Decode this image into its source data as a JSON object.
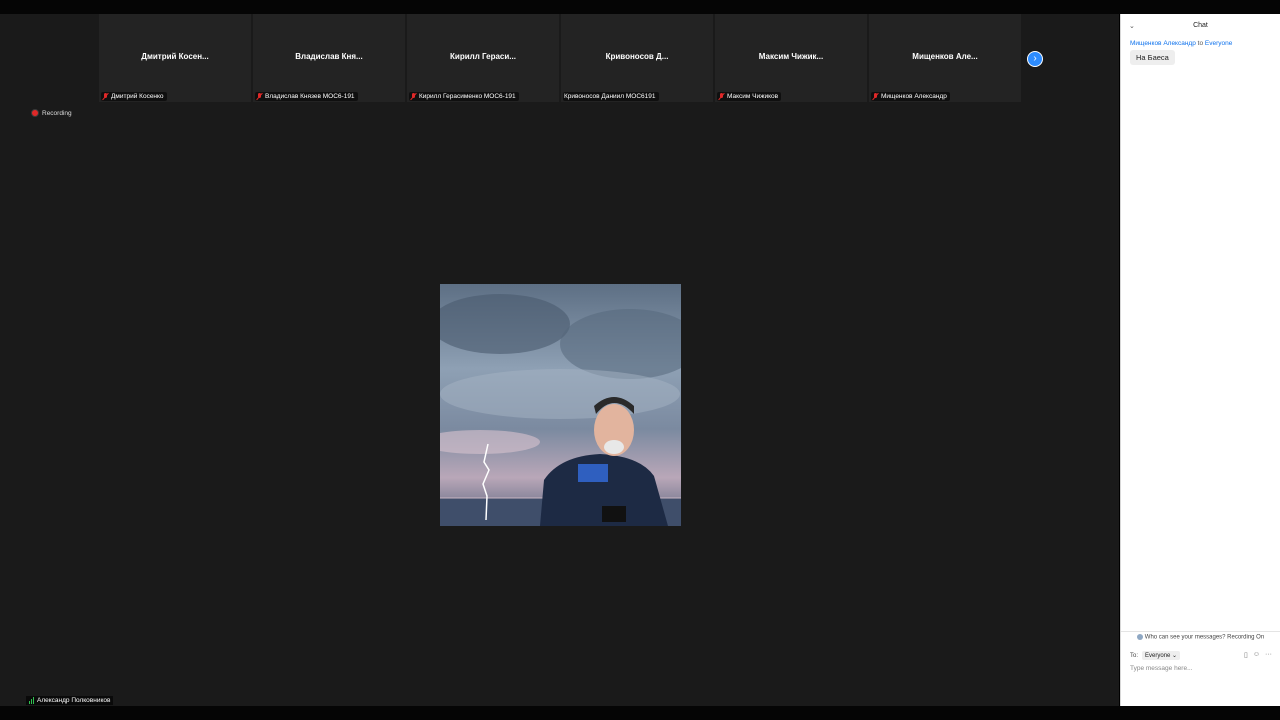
{
  "participants": [
    {
      "tile_title": "Дмитрий  Косен...",
      "name": "Дмитрий Косенко",
      "muted": true
    },
    {
      "tile_title": "Владислав  Кня...",
      "name": "Владислав Князев МОС6-191",
      "muted": true
    },
    {
      "tile_title": "Кирилл  Гераси...",
      "name": "Кирилл Герасименко МОС6-191",
      "muted": true
    },
    {
      "tile_title": "Кривоносов  Д...",
      "name": "Кривоносов Даниил МОС6191",
      "muted": false
    },
    {
      "tile_title": "Максим  Чижик...",
      "name": "Максим Чижиков",
      "muted": true
    },
    {
      "tile_title": "Мищенков  Але...",
      "name": "Мищенков Александр",
      "muted": true
    }
  ],
  "recording": {
    "label": "Recording"
  },
  "active_speaker": {
    "name": "Александр Полковников"
  },
  "chat": {
    "title": "Chat",
    "messages": [
      {
        "sender": "Мищенков Александр",
        "to_word": "to",
        "recipient": "Everyone",
        "text": "На Баеса"
      }
    ],
    "who_can_see": "Who can see your messages? Recording On",
    "to_label": "To:",
    "to_value": "Everyone",
    "placeholder": "Type message here..."
  },
  "icons": {
    "next_page": "chevron-right-icon",
    "mic": "mic-muted-icon",
    "signal": "signal-bars-icon",
    "file": "file-icon",
    "emoji": "emoji-icon",
    "more": "more-icon"
  },
  "colors": {
    "accent": "#0e72ed",
    "muted": "#e02828",
    "background": "#1a1a1a"
  }
}
